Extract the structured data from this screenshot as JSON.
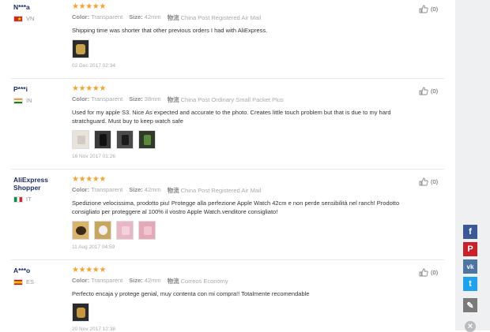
{
  "labels": {
    "color": "Color:",
    "size": "Size:",
    "logistics": "物流"
  },
  "reviews": [
    {
      "user": "N***a",
      "country": "VN",
      "color": "Transparent",
      "size": "42mm",
      "logistics": "China Post Registered Air Mail",
      "text": "Shipping time was shorter that other previous orders I had with AliExpress.",
      "date": "02 Dec 2017 02:34",
      "helpful": "(0)"
    },
    {
      "user": "P***i",
      "country": "IN",
      "color": "Transparent",
      "size": "38mm",
      "logistics": "China Post Ordinary Small Packet Plus",
      "text": "Used for my apple S3. Nice As expected and accurate to the photo. Creates little touch problem but that is due to my hard stratchguard. Must buy to keep watch safe",
      "date": "16 Nov 2017 01:26",
      "helpful": "(0)"
    },
    {
      "user": "AliExpress Shopper",
      "country": "IT",
      "color": "Transparent",
      "size": "42mm",
      "logistics": "China Post Registered Air Mail",
      "text": "Spedizione velocissima, prodotto piu! Protegge alla perfezione Apple Watch 42cm e non perde sensibilità nel ranch! Prodotto consigliato per proteggere al 100% il vostro Apple Watch.venditore consigliato!",
      "date": "11 Aug 2017 04:59",
      "helpful": "(0)"
    },
    {
      "user": "A***o",
      "country": "ES",
      "color": "Transparent",
      "size": "42mm",
      "logistics": "Correos Economy",
      "text": "Perfecto encaja y protege genial, muy contenta con mi compra!! Totalmente recomendable",
      "date": "20 Nov 2017 12:38",
      "helpful": "(0)"
    }
  ],
  "share": [
    {
      "name": "facebook",
      "glyph": "f",
      "color": "#3b5998"
    },
    {
      "name": "pinterest",
      "glyph": "P",
      "color": "#cb2027"
    },
    {
      "name": "vk",
      "glyph": "vk",
      "color": "#4c75a3"
    },
    {
      "name": "twitter",
      "glyph": "t",
      "color": "#1da1f2"
    },
    {
      "name": "edit",
      "glyph": "✎",
      "color": "#7a7a7a"
    },
    {
      "name": "close",
      "glyph": "×",
      "color": "#b9bcc0"
    }
  ]
}
